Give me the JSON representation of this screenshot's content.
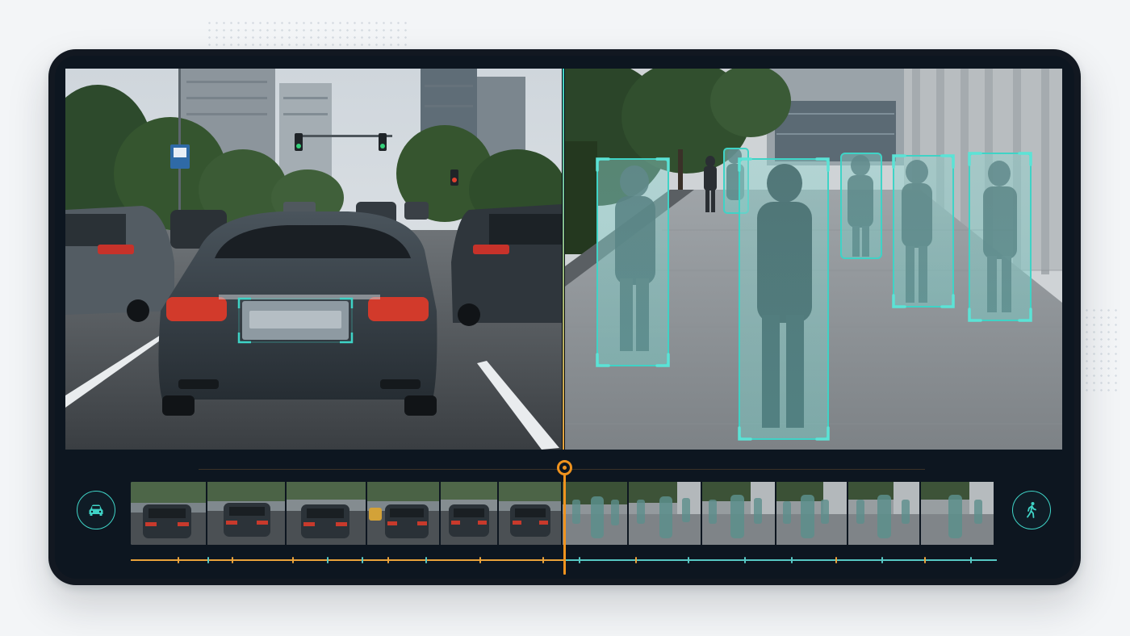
{
  "colors": {
    "accent_teal": "#3fd3c6",
    "accent_orange": "#f0931e",
    "device_bg": "#121821",
    "page_bg": "#f3f5f7"
  },
  "left_view": {
    "scene": "street-traffic",
    "detection": "license-plate-blur"
  },
  "right_view": {
    "scene": "sidewalk-pedestrians",
    "detection": "pedestrian-blur",
    "pedestrian_count": 6
  },
  "timeline": {
    "left_mode_icon": "car-icon",
    "right_mode_icon": "walking-person-icon",
    "thumbnails_vehicle": 6,
    "thumbnails_pedestrian": 6,
    "playhead_fraction": 0.5
  }
}
